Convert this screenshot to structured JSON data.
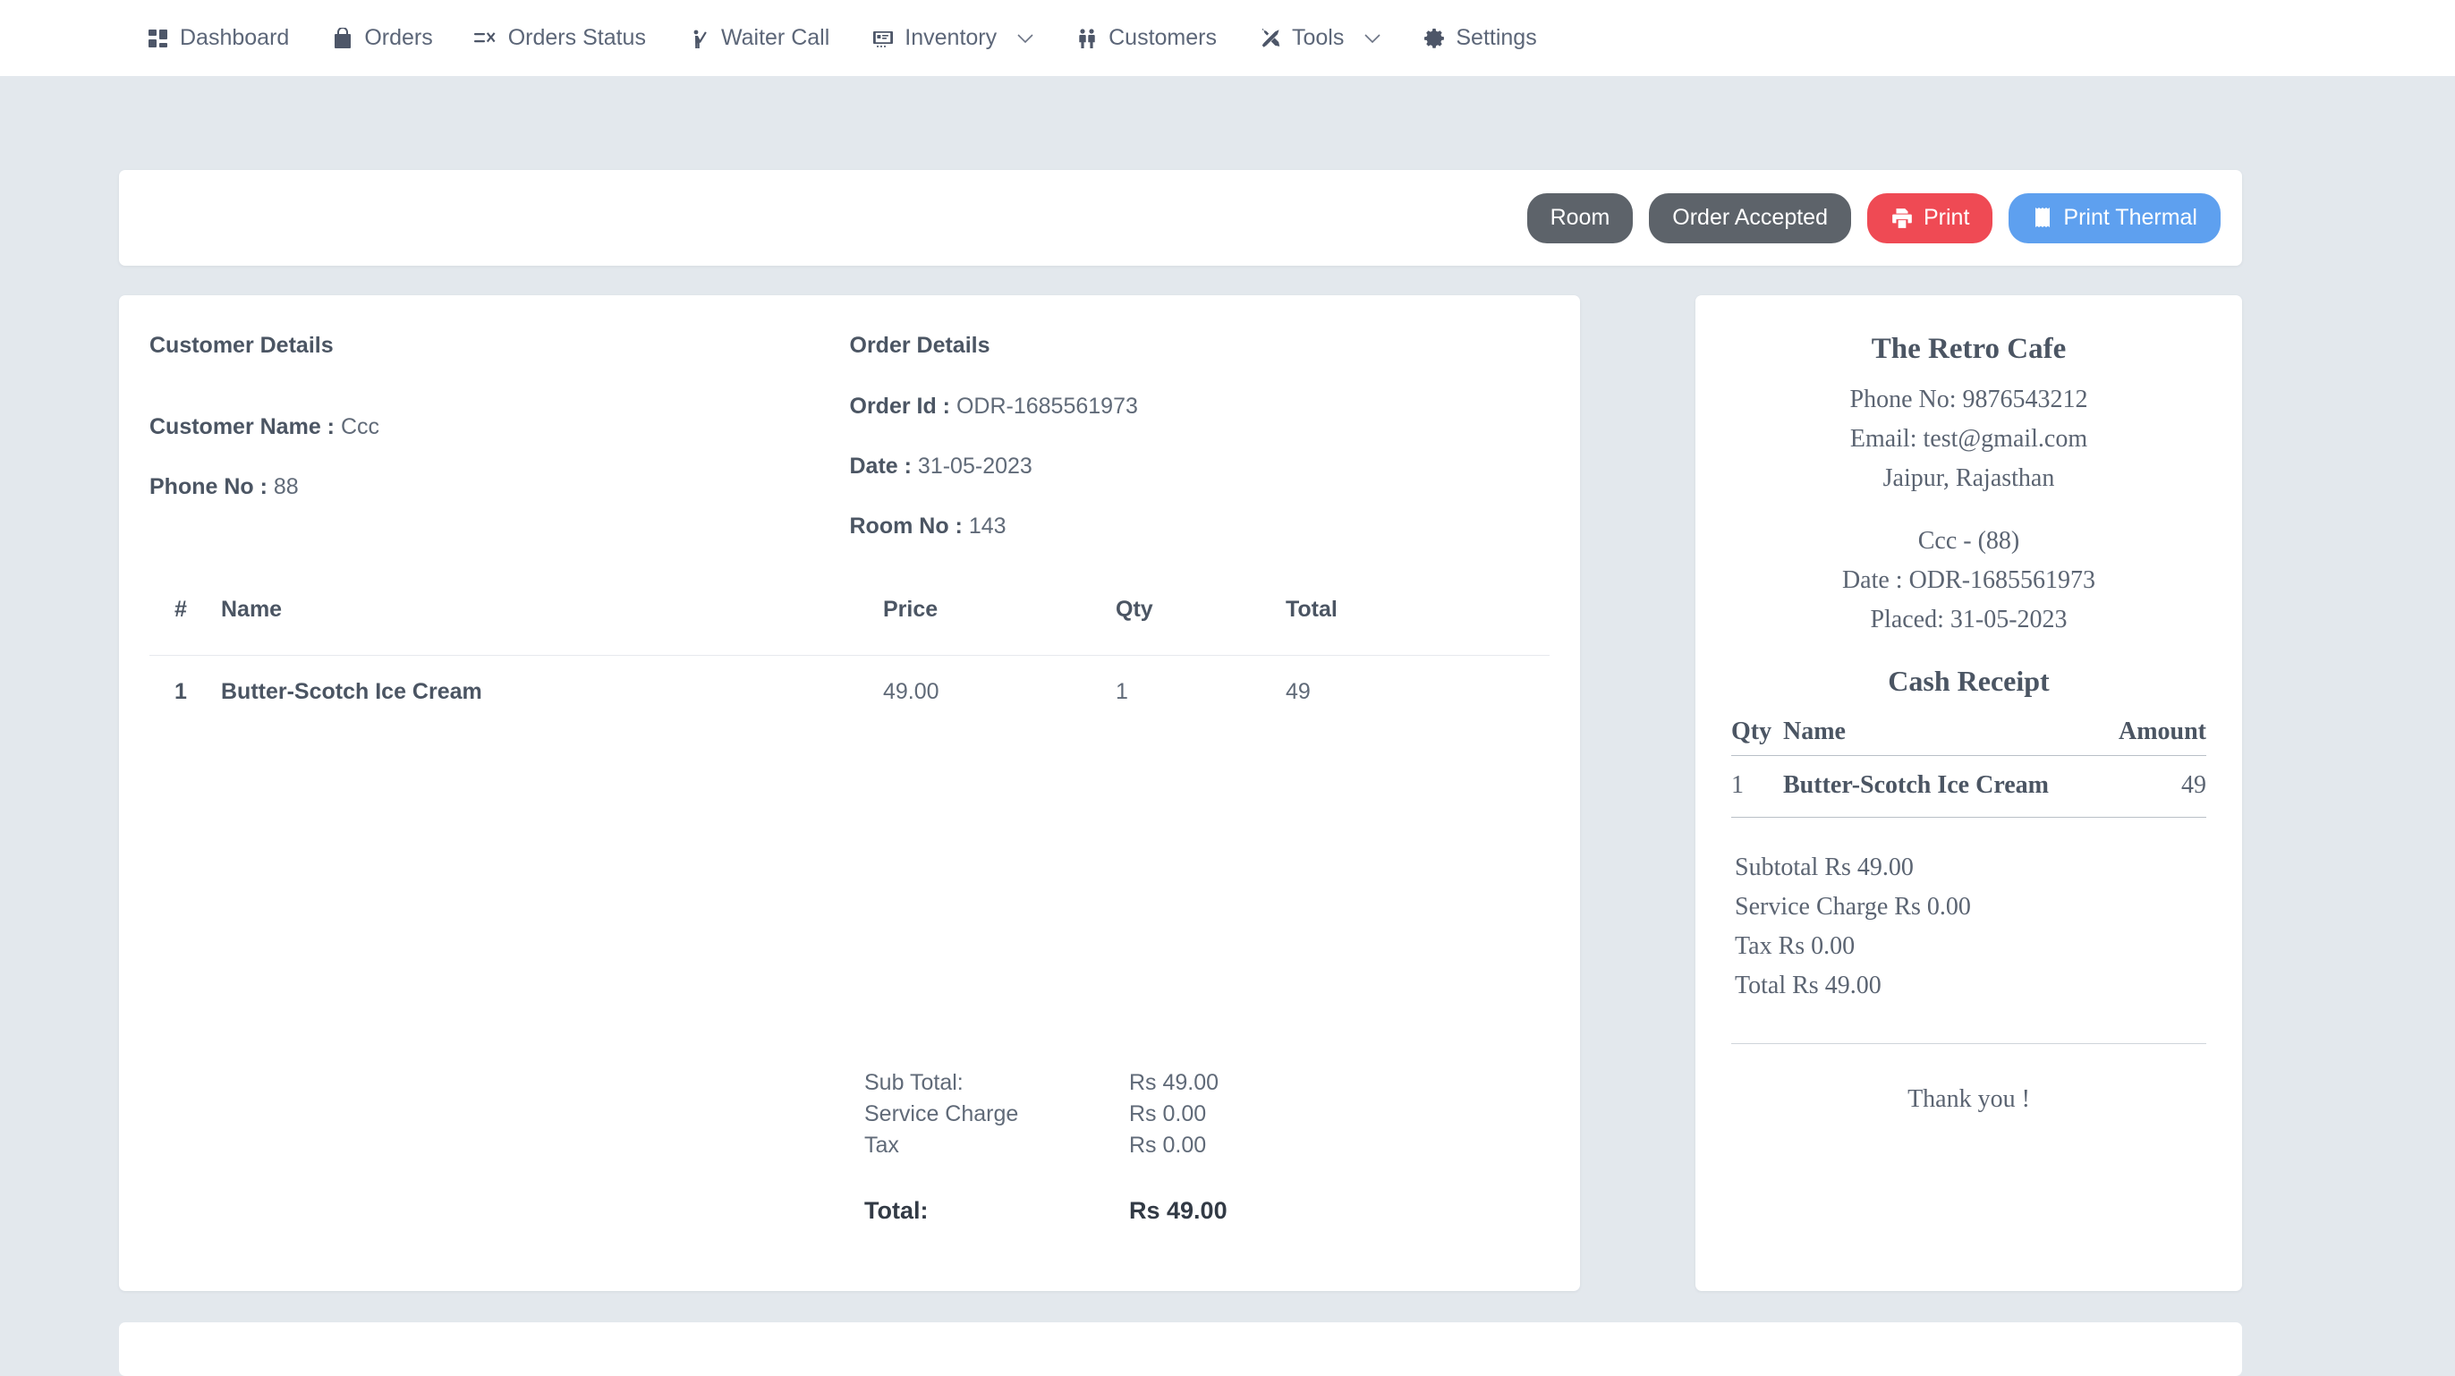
{
  "nav": {
    "items": [
      {
        "label": "Dashboard",
        "icon": "grid-icon",
        "dropdown": false
      },
      {
        "label": "Orders",
        "icon": "shopping-bag-icon",
        "dropdown": false
      },
      {
        "label": "Orders Status",
        "icon": "list-check-icon",
        "dropdown": false
      },
      {
        "label": "Waiter Call",
        "icon": "waiter-hand-icon",
        "dropdown": false
      },
      {
        "label": "Inventory",
        "icon": "inventory-box-icon",
        "dropdown": true
      },
      {
        "label": "Customers",
        "icon": "users-icon",
        "dropdown": false
      },
      {
        "label": "Tools",
        "icon": "tools-icon",
        "dropdown": true
      },
      {
        "label": "Settings",
        "icon": "gear-icon",
        "dropdown": false
      }
    ]
  },
  "toolbar": {
    "room_label": "Room",
    "status_label": "Order Accepted",
    "print_label": "Print",
    "print_thermal_label": "Print Thermal",
    "colors": {
      "dark": "#5d636a",
      "red": "#ef4a54",
      "blue": "#5ea0ef"
    }
  },
  "customer": {
    "section_title": "Customer Details",
    "name_label": "Customer Name :",
    "name_value": "Ccc",
    "phone_label": "Phone No :",
    "phone_value": "88"
  },
  "order": {
    "section_title": "Order Details",
    "order_id_label": "Order Id :",
    "order_id_value": "ODR-1685561973",
    "date_label": "Date :",
    "date_value": "31-05-2023",
    "room_label": "Room No :",
    "room_value": "143"
  },
  "items_table": {
    "headers": [
      "#",
      "Name",
      "Price",
      "Qty",
      "Total"
    ],
    "rows": [
      {
        "index": "1",
        "name": "Butter-Scotch Ice Cream",
        "price": "49.00",
        "qty": "1",
        "total": "49"
      }
    ]
  },
  "totals": {
    "subtotal_label": "Sub Total:",
    "subtotal_value": "Rs 49.00",
    "service_label": "Service Charge",
    "service_value": "Rs 0.00",
    "tax_label": "Tax",
    "tax_value": "Rs 0.00",
    "grand_label": "Total:",
    "grand_value": "Rs 49.00"
  },
  "receipt": {
    "store_name": "The Retro Cafe",
    "phone": "Phone No: 9876543212",
    "email": "Email: test@gmail.com",
    "address": "Jaipur, Rajasthan",
    "customer_line": "Ccc - (88)",
    "date_line": "Date : ODR-1685561973",
    "placed_line": "Placed: 31-05-2023",
    "heading": "Cash Receipt",
    "headers": [
      "Qty",
      "Name",
      "Amount"
    ],
    "rows": [
      {
        "qty": "1",
        "name": "Butter-Scotch Ice Cream",
        "amount": "49"
      }
    ],
    "subtotal": "Subtotal Rs 49.00",
    "service_charge": "Service Charge Rs 0.00",
    "tax": "Tax Rs 0.00",
    "total": "Total Rs 49.00",
    "thanks": "Thank you !"
  }
}
